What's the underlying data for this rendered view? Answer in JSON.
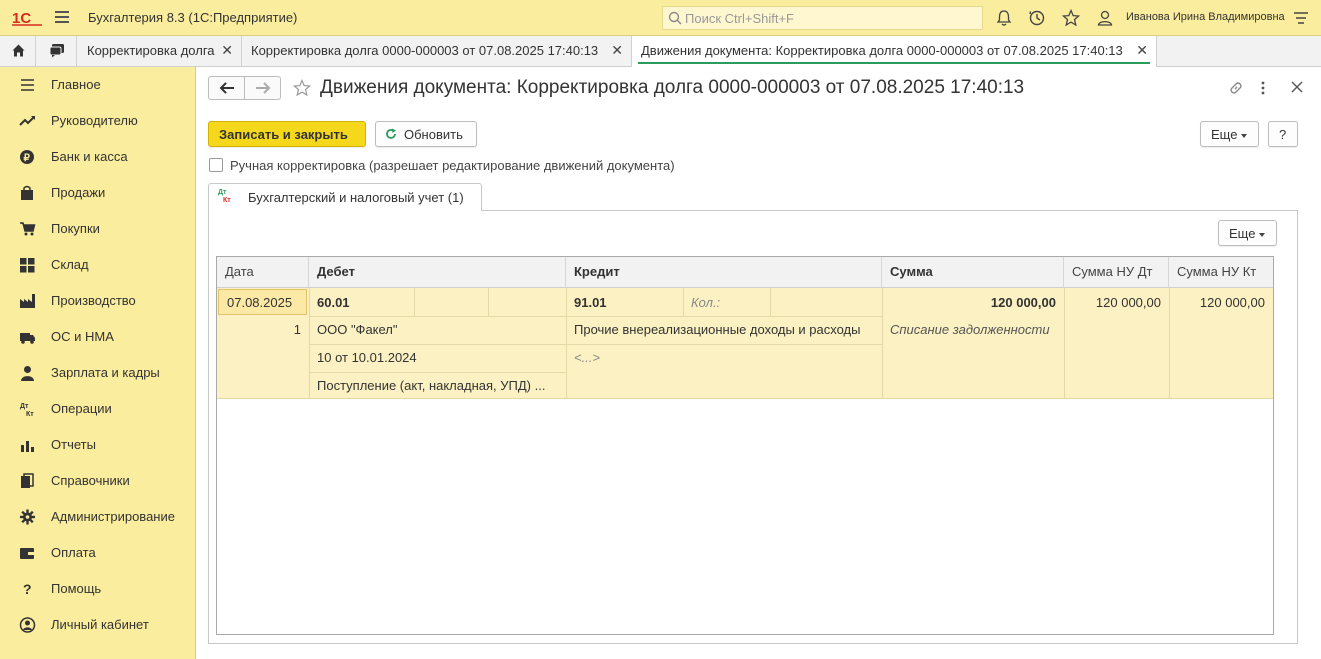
{
  "app": {
    "title": "Бухгалтерия 8.3  (1С:Предприятие)",
    "search_placeholder": "Поиск Ctrl+Shift+F",
    "user": "Иванова Ирина Владимировна"
  },
  "tabs": [
    {
      "label": "Корректировка долга"
    },
    {
      "label": "Корректировка долга 0000-000003 от 07.08.2025 17:40:13"
    },
    {
      "label": "Движения документа: Корректировка долга 0000-000003 от 07.08.2025 17:40:13"
    }
  ],
  "sidebar": {
    "items": [
      {
        "label": "Главное",
        "icon": "menu-lines-icon"
      },
      {
        "label": "Руководителю",
        "icon": "trend-icon"
      },
      {
        "label": "Банк и касса",
        "icon": "ruble-coin-icon"
      },
      {
        "label": "Продажи",
        "icon": "shopping-bag-icon"
      },
      {
        "label": "Покупки",
        "icon": "cart-icon"
      },
      {
        "label": "Склад",
        "icon": "warehouse-grid-icon"
      },
      {
        "label": "Производство",
        "icon": "factory-icon"
      },
      {
        "label": "ОС и НМА",
        "icon": "truck-icon"
      },
      {
        "label": "Зарплата и кадры",
        "icon": "person-icon"
      },
      {
        "label": "Операции",
        "icon": "dt-kt-icon"
      },
      {
        "label": "Отчеты",
        "icon": "bar-chart-icon"
      },
      {
        "label": "Справочники",
        "icon": "books-icon"
      },
      {
        "label": "Администрирование",
        "icon": "gear-icon"
      },
      {
        "label": "Оплата",
        "icon": "wallet-icon"
      },
      {
        "label": "Помощь",
        "icon": "question-icon"
      },
      {
        "label": "Личный кабинет",
        "icon": "user-circle-icon"
      }
    ]
  },
  "document": {
    "title": "Движения документа: Корректировка долга 0000-000003 от 07.08.2025 17:40:13",
    "save_close": "Записать и закрыть",
    "refresh": "Обновить",
    "more": "Еще",
    "help": "?",
    "manual_correction": "Ручная корректировка (разрешает редактирование движений документа)",
    "manual_correction_checked": false,
    "inner_tab": "Бухгалтерский и налоговый учет (1)",
    "dt": "Дт",
    "kt": "Кт",
    "table_more": "Еще"
  },
  "table": {
    "headers": {
      "date": "Дата",
      "debit": "Дебет",
      "credit": "Кредит",
      "sum": "Сумма",
      "sum_nu_dt": "Сумма НУ Дт",
      "sum_nu_kt": "Сумма НУ Кт"
    },
    "row": {
      "date": "07.08.2025",
      "number": "1",
      "debit_account": "60.01",
      "debit_sub1": "ООО \"Факел\"",
      "debit_sub2": "10 от 10.01.2024",
      "debit_sub3": "Поступление (акт, накладная, УПД) ...",
      "credit_account": "91.01",
      "credit_qty_label": "Кол.:",
      "credit_sub1": "Прочие внереализационные доходы и расходы",
      "credit_sub2": "<...>",
      "sum": "120 000,00",
      "content": "Списание задолженности",
      "sum_nu_dt": "120 000,00",
      "sum_nu_kt": "120 000,00"
    }
  },
  "colors": {
    "accent_yellow": "#f5d81b",
    "panel_yellow": "#fbed9e",
    "row_highlight": "#fcf1c2",
    "active_tab_underline": "#2a9d5c",
    "logo_red": "#d92b1f"
  }
}
